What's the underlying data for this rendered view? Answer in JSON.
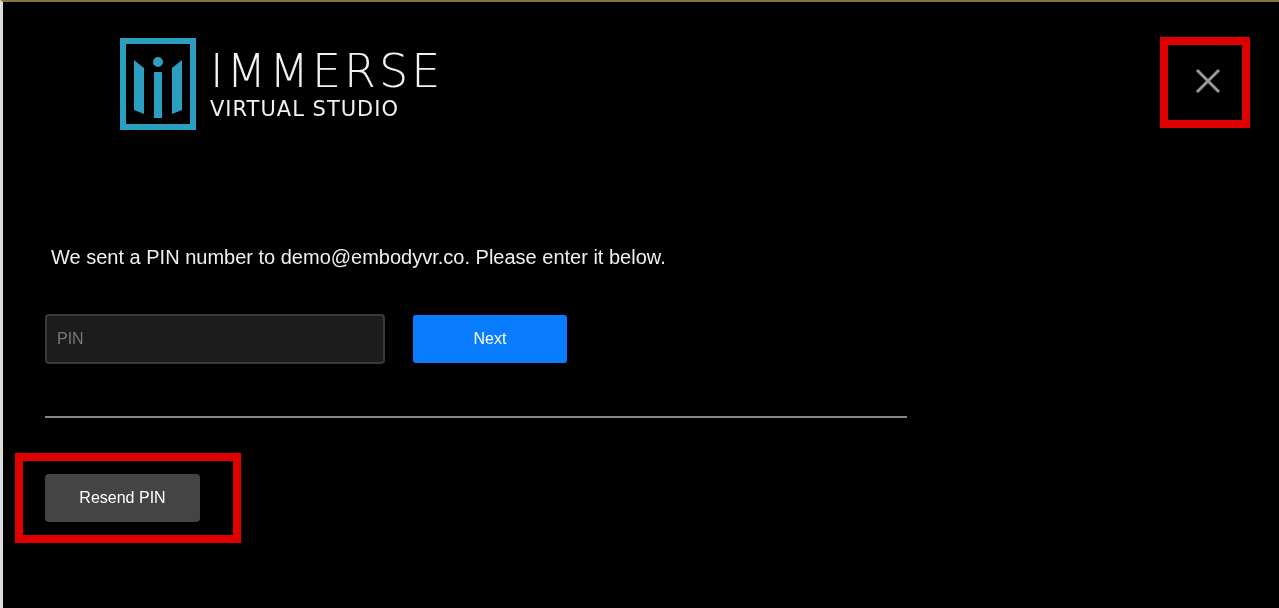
{
  "logo": {
    "title": "IMMERSE",
    "subtitle": "VIRTUAL STUDIO"
  },
  "close_button": {
    "highlighted": true
  },
  "message": "We sent a PIN number to demo@embodyvr.co. Please enter it below.",
  "pin_field": {
    "placeholder": "PIN"
  },
  "next_button": {
    "label": "Next"
  },
  "resend_button": {
    "label": "Resend PIN",
    "highlighted": true
  }
}
